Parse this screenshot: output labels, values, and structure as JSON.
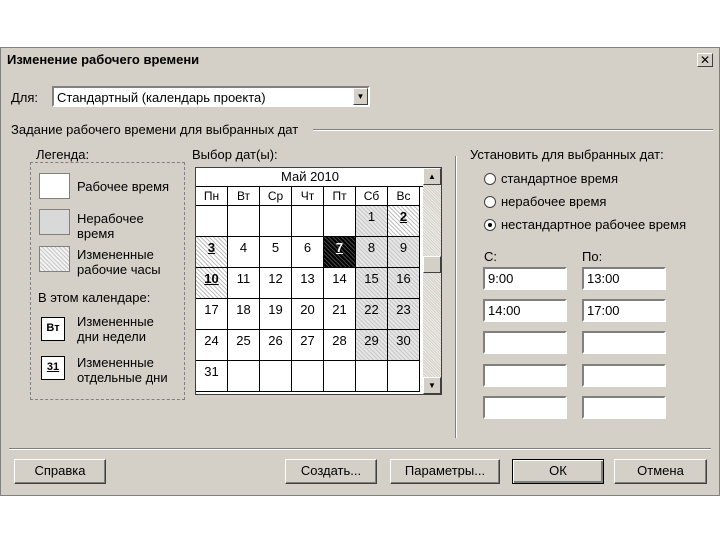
{
  "window": {
    "title": "Изменение рабочего времени",
    "close_glyph": "✕"
  },
  "for_field": {
    "label": "Для:",
    "value": "Стандартный (календарь проекта)"
  },
  "section_title": "Задание рабочего времени для выбранных дат",
  "legend": {
    "title": "Легенда:",
    "items": [
      {
        "label": "Рабочее время"
      },
      {
        "label": "Нерабочее\nвремя"
      },
      {
        "label": "Измененные\nрабочие часы"
      }
    ],
    "in_calendar_title": "В этом календаре:",
    "calendar_items": [
      {
        "icon_text": "Вт",
        "label": "Измененные\nдни недели"
      },
      {
        "icon_text": "31",
        "label": "Измененные\nотдельные дни"
      }
    ]
  },
  "date_select": {
    "title": "Выбор дат(ы):",
    "month": "Май 2010",
    "weekdays": [
      "Пн",
      "Вт",
      "Ср",
      "Чт",
      "Пт",
      "Сб",
      "Вс"
    ],
    "weeks": [
      [
        "",
        "",
        "",
        "",
        "",
        "1",
        "2"
      ],
      [
        "3",
        "4",
        "5",
        "6",
        "7",
        "8",
        "9"
      ],
      [
        "10",
        "11",
        "12",
        "13",
        "14",
        "15",
        "16"
      ],
      [
        "17",
        "18",
        "19",
        "20",
        "21",
        "22",
        "23"
      ],
      [
        "24",
        "25",
        "26",
        "27",
        "28",
        "29",
        "30"
      ],
      [
        "31",
        "",
        "",
        "",
        "",
        "",
        ""
      ]
    ]
  },
  "set_dates": {
    "title": "Установить для выбранных дат:",
    "options": [
      {
        "label": "стандартное время",
        "checked": false
      },
      {
        "label": "нерабочее время",
        "checked": false
      },
      {
        "label": "нестандартное рабочее время",
        "checked": true
      }
    ],
    "from_label": "С:",
    "to_label": "По:",
    "rows": [
      {
        "from": "9:00",
        "to": "13:00"
      },
      {
        "from": "14:00",
        "to": "17:00"
      },
      {
        "from": "",
        "to": ""
      },
      {
        "from": "",
        "to": ""
      },
      {
        "from": "",
        "to": ""
      }
    ]
  },
  "buttons": {
    "help": "Справка",
    "create": "Создать...",
    "params": "Параметры...",
    "ok": "ОК",
    "cancel": "Отмена"
  },
  "scroll": {
    "up_glyph": "▲",
    "down_glyph": "▼",
    "combo_glyph": "▼"
  }
}
